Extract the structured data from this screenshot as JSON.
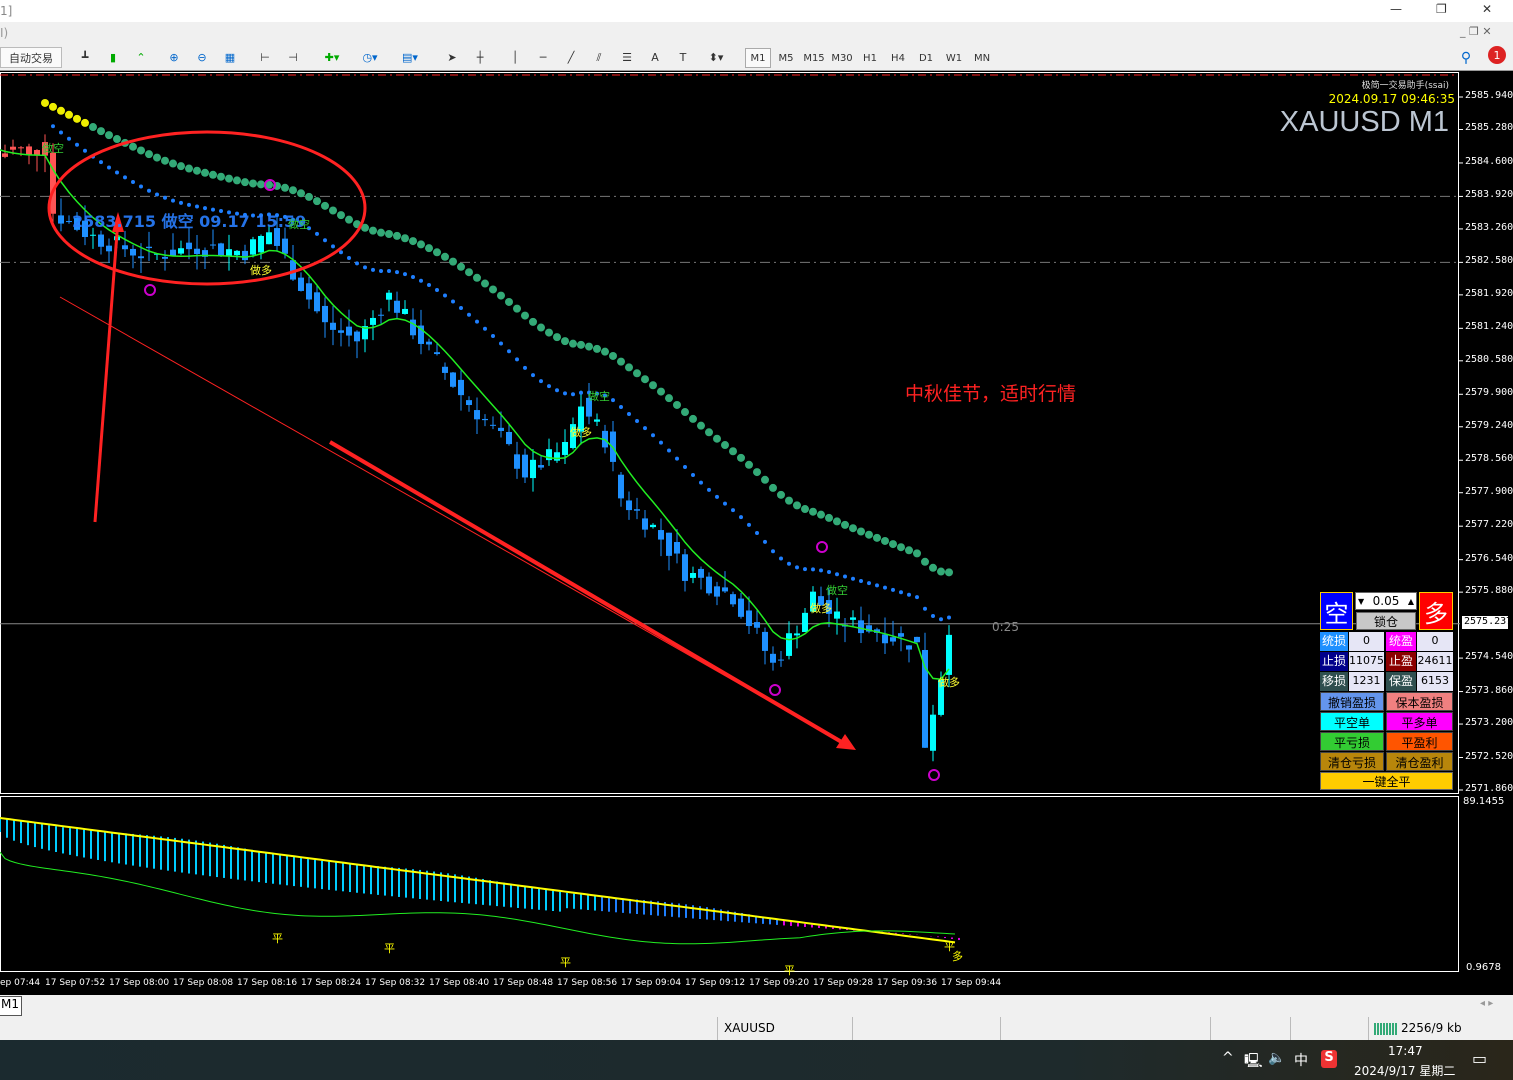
{
  "window": {
    "title_fragment": "1]",
    "menu_fragment": "I)",
    "minimize": "—",
    "restore": "❐",
    "close": "✕"
  },
  "toolbar": {
    "auto_trade": "自动交易",
    "timeframes": [
      "M1",
      "M5",
      "M15",
      "M30",
      "H1",
      "H4",
      "D1",
      "W1",
      "MN"
    ],
    "active_timeframe": "M1",
    "notification_count": "1"
  },
  "chart": {
    "symbol_title": "XAUUSD M1",
    "indicator_name": "极简一交易助手(ssai)",
    "server_time": "2024.09.17 09:46:35",
    "annotation_text": "中秋佳节，适时行情",
    "signal_label": "2583.715 做空 09.17 15:59",
    "bar_timer": "0:25",
    "current_price": "2575.237",
    "price_labels": [
      "2585.940",
      "2585.280",
      "2584.600",
      "2583.920",
      "2583.260",
      "2582.580",
      "2581.920",
      "2581.240",
      "2580.580",
      "2579.900",
      "2579.240",
      "2578.560",
      "2577.900",
      "2577.220",
      "2576.540",
      "2575.880",
      "2574.540",
      "2573.860",
      "2573.200",
      "2572.520",
      "2571.860"
    ],
    "sub_labels": [
      "89.1455",
      "0.9678"
    ],
    "signals": [
      {
        "t": "做空",
        "c": "#33cc33"
      },
      {
        "t": "做多",
        "c": "#ffff33"
      },
      {
        "t": "做空",
        "c": "#33cc33"
      },
      {
        "t": "做多",
        "c": "#ffff33"
      },
      {
        "t": "做空",
        "c": "#33cc33"
      },
      {
        "t": "做多",
        "c": "#ffff33"
      },
      {
        "t": "做空",
        "c": "#33cc33"
      },
      {
        "t": "做多",
        "c": "#ffff33"
      }
    ],
    "sub_marks": [
      "平",
      "平",
      "平",
      "平",
      "平",
      "多"
    ],
    "time_labels": [
      "ep 07:44",
      "17 Sep 07:52",
      "17 Sep 08:00",
      "17 Sep 08:08",
      "17 Sep 08:16",
      "17 Sep 08:24",
      "17 Sep 08:32",
      "17 Sep 08:40",
      "17 Sep 08:48",
      "17 Sep 08:56",
      "17 Sep 09:04",
      "17 Sep 09:12",
      "17 Sep 09:20",
      "17 Sep 09:28",
      "17 Sep 09:36",
      "17 Sep 09:44"
    ],
    "price_path": [
      [
        "07:46",
        2584.8
      ],
      [
        "07:52",
        2584.9
      ],
      [
        "07:53",
        2583.6
      ],
      [
        "07:58",
        2583.1
      ],
      [
        "08:05",
        2582.7
      ],
      [
        "08:11",
        2582.9
      ],
      [
        "08:17",
        2582.8
      ],
      [
        "08:20",
        2583.2
      ],
      [
        "08:23",
        2582.4
      ],
      [
        "08:27",
        2581.3
      ],
      [
        "08:31",
        2581.0
      ],
      [
        "08:35",
        2581.9
      ],
      [
        "08:39",
        2581.0
      ],
      [
        "08:44",
        2579.9
      ],
      [
        "08:49",
        2579.0
      ],
      [
        "08:52",
        2578.3
      ],
      [
        "08:57",
        2578.8
      ],
      [
        "08:59",
        2579.7
      ],
      [
        "09:02",
        2579.0
      ],
      [
        "09:04",
        2577.8
      ],
      [
        "09:08",
        2577.2
      ],
      [
        "09:12",
        2576.3
      ],
      [
        "09:18",
        2575.8
      ],
      [
        "09:21",
        2575.0
      ],
      [
        "09:23",
        2574.4
      ],
      [
        "09:26",
        2575.2
      ],
      [
        "09:28",
        2575.8
      ],
      [
        "09:31",
        2575.3
      ],
      [
        "09:36",
        2575.1
      ],
      [
        "09:41",
        2574.8
      ],
      [
        "09:42",
        2572.8
      ],
      [
        "09:44",
        2574.2
      ],
      [
        "09:45",
        2575.2
      ]
    ]
  },
  "panel": {
    "sell": "空",
    "buy": "多",
    "lot": "0.05",
    "lock": "锁仓",
    "rows": [
      [
        "统损",
        "0",
        "统盈",
        "0"
      ],
      [
        "止损",
        "11075",
        "止盈",
        "24611"
      ],
      [
        "移损",
        "1231",
        "保盈",
        "6153"
      ]
    ],
    "buttons": [
      "撤销盈损",
      "保本盈损",
      "平空单",
      "平多单",
      "平亏损",
      "平盈利",
      "清仓亏损",
      "清仓盈利"
    ],
    "close_all": "一键全平"
  },
  "tabs": [
    "M1"
  ],
  "status": {
    "symbol": "XAUUSD",
    "traffic": "2256/9 kb"
  },
  "taskbar": {
    "time": "17:47",
    "date": "2024/9/17 星期二",
    "ime": "中"
  }
}
